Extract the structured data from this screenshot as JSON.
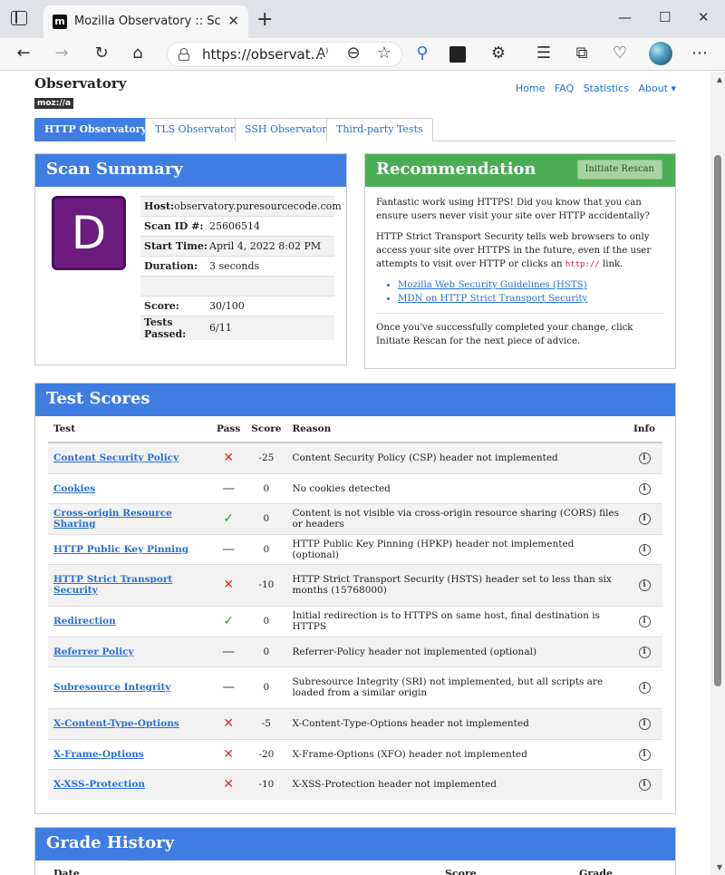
{
  "browser": {
    "tab_title": "Mozilla Observatory :: Scan Resul",
    "favicon_text": "m",
    "url": "https://observat...",
    "reader_text": "A⁾"
  },
  "site": {
    "brand": "Observatory",
    "brand_sub": "moz://a",
    "nav": [
      "Home",
      "FAQ",
      "Statistics",
      "About ▾"
    ],
    "tabs": [
      "HTTP Observatory",
      "TLS Observatory",
      "SSH Observatory",
      "Third-party Tests"
    ]
  },
  "scan_summary": {
    "title": "Scan Summary",
    "grade": "D",
    "rows": [
      {
        "k": "Host:",
        "v": "observatory.puresourcecode.com"
      },
      {
        "k": "Scan ID #:",
        "v": "25606514"
      },
      {
        "k": "Start Time:",
        "v": "April 4, 2022 8:02 PM"
      },
      {
        "k": "Duration:",
        "v": "3 seconds"
      },
      {
        "k": "",
        "v": ""
      },
      {
        "k": "Score:",
        "v": "30/100"
      },
      {
        "k": "Tests Passed:",
        "v": "6/11"
      }
    ]
  },
  "recommendation": {
    "title": "Recommendation",
    "button": "Initiate Rescan",
    "p1": "Fantastic work using HTTPS! Did you know that you can ensure users never visit your site over HTTP accidentally?",
    "p2a": "HTTP Strict Transport Security tells web browsers to only access your site over HTTPS in the future, even if the user attempts to visit over HTTP or clicks an ",
    "p2code": "http://",
    "p2b": " link.",
    "links": [
      "Mozilla Web Security Guidelines (HSTS)",
      "MDN on HTTP Strict Transport Security"
    ],
    "p3": "Once you've successfully completed your change, click Initiate Rescan for the next piece of advice."
  },
  "test_scores": {
    "title": "Test Scores",
    "headers": [
      "Test",
      "Pass",
      "Score",
      "Reason",
      "Info"
    ],
    "rows": [
      {
        "test": "Content Security Policy",
        "pass": "fail",
        "score": "-25",
        "reason": "Content Security Policy (CSP) header not implemented"
      },
      {
        "test": "Cookies",
        "pass": "na",
        "score": "0",
        "reason": "No cookies detected"
      },
      {
        "test": "Cross-origin Resource Sharing",
        "pass": "pass",
        "score": "0",
        "reason": "Content is not visible via cross-origin resource sharing (CORS) files or headers"
      },
      {
        "test": "HTTP Public Key Pinning",
        "pass": "na",
        "score": "0",
        "reason": "HTTP Public Key Pinning (HPKP) header not implemented (optional)"
      },
      {
        "test": "HTTP Strict Transport Security",
        "pass": "fail",
        "score": "-10",
        "reason": "HTTP Strict Transport Security (HSTS) header set to less than six months (15768000)"
      },
      {
        "test": "Redirection",
        "pass": "pass",
        "score": "0",
        "reason": "Initial redirection is to HTTPS on same host, final destination is HTTPS"
      },
      {
        "test": "Referrer Policy",
        "pass": "na",
        "score": "0",
        "reason": "Referrer-Policy header not implemented (optional)"
      },
      {
        "test": "Subresource Integrity",
        "pass": "na",
        "score": "0",
        "reason": "Subresource Integrity (SRI) not implemented, but all scripts are loaded from a similar origin"
      },
      {
        "test": "X-Content-Type-Options",
        "pass": "fail",
        "score": "-5",
        "reason": "X-Content-Type-Options header not implemented"
      },
      {
        "test": "X-Frame-Options",
        "pass": "fail",
        "score": "-20",
        "reason": "X-Frame-Options (XFO) header not implemented"
      },
      {
        "test": "X-XSS-Protection",
        "pass": "fail",
        "score": "-10",
        "reason": "X-XSS-Protection header not implemented"
      }
    ]
  },
  "grade_history": {
    "title": "Grade History",
    "headers": [
      "Date",
      "Score",
      "Grade"
    ]
  },
  "colors": {
    "panel_blue": "#3f7de2",
    "panel_green": "#4bad54",
    "grade_purple": "#6c1c7f",
    "link": "#2a6fd6",
    "fail": "#d9302c",
    "pass": "#2e9b3a"
  },
  "icons": {
    "pass": "✓",
    "fail": "✕",
    "na": "—",
    "info": "i"
  }
}
